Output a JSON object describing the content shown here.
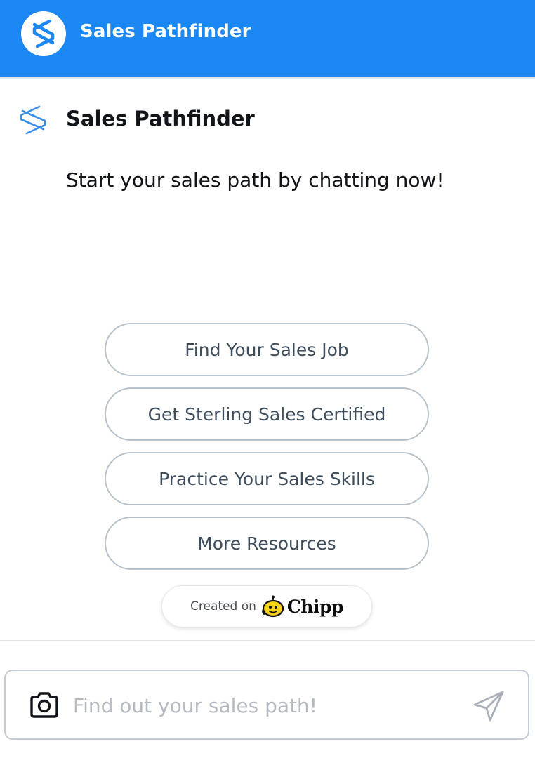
{
  "header": {
    "title": "Sales Pathfinder",
    "logo_icon": "sterling-s-logo-icon",
    "background_color": "#1b87f3"
  },
  "chat": {
    "bot_name": "Sales Pathfinder",
    "bot_icon": "sterling-s-logo-icon",
    "messages": [
      {
        "role": "bot",
        "text": "Start your sales path by chatting now!"
      }
    ]
  },
  "suggestions": [
    {
      "label": "Find Your Sales Job"
    },
    {
      "label": "Get Sterling Sales Certified"
    },
    {
      "label": "Practice Your Sales Skills"
    },
    {
      "label": "More Resources"
    }
  ],
  "badge": {
    "created_on": "Created on",
    "brand": "Chipp",
    "brand_icon": "chipp-mascot-icon"
  },
  "composer": {
    "placeholder": "Find out your sales path!",
    "camera_icon": "camera-icon",
    "send_icon": "send-icon"
  },
  "colors": {
    "accent": "#1b87f3",
    "button_border": "#b8c3cc",
    "button_text": "#3d4d5c"
  }
}
